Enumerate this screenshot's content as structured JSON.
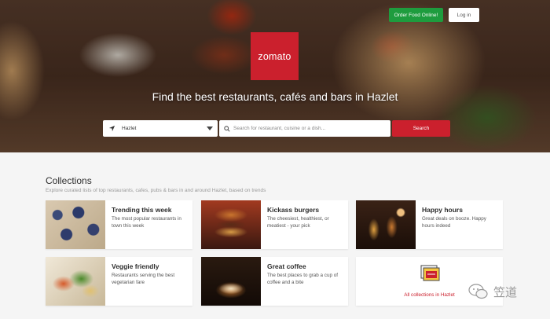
{
  "header": {
    "order_food_label": "Order Food Online!",
    "login_label": "Log in"
  },
  "brand": {
    "logo_text": "zomato",
    "color": "#cb202d"
  },
  "hero": {
    "tagline": "Find the best restaurants, cafés and bars in Hazlet",
    "location_value": "Hazlet",
    "search_placeholder": "Search for restaurant, cuisine or a dish...",
    "search_button_label": "Search"
  },
  "collections": {
    "title": "Collections",
    "subtitle": "Explore curated lists of top restaurants, cafes, pubs & bars in and around Hazlet, based on trends",
    "cards": [
      {
        "title": "Trending this week",
        "desc": "The most popular restaurants in town this week"
      },
      {
        "title": "Kickass burgers",
        "desc": "The cheesiest, healthiest, or meatiest - your pick"
      },
      {
        "title": "Happy hours",
        "desc": "Great deals on booze. Happy hours indeed"
      },
      {
        "title": "Veggie friendly",
        "desc": "Restaurants serving the best vegetarian fare"
      },
      {
        "title": "Great coffee",
        "desc": "The best places to grab a cup of coffee and a bite"
      }
    ],
    "all_label": "All collections in Hazlet"
  },
  "watermark": {
    "text": "笠道"
  },
  "colors": {
    "accent": "#cb202d",
    "order_green": "#1e9c3e"
  },
  "icons": [
    "location-arrow-icon",
    "search-icon",
    "dropdown-caret-icon",
    "collections-folder-icon",
    "wechat-icon"
  ]
}
